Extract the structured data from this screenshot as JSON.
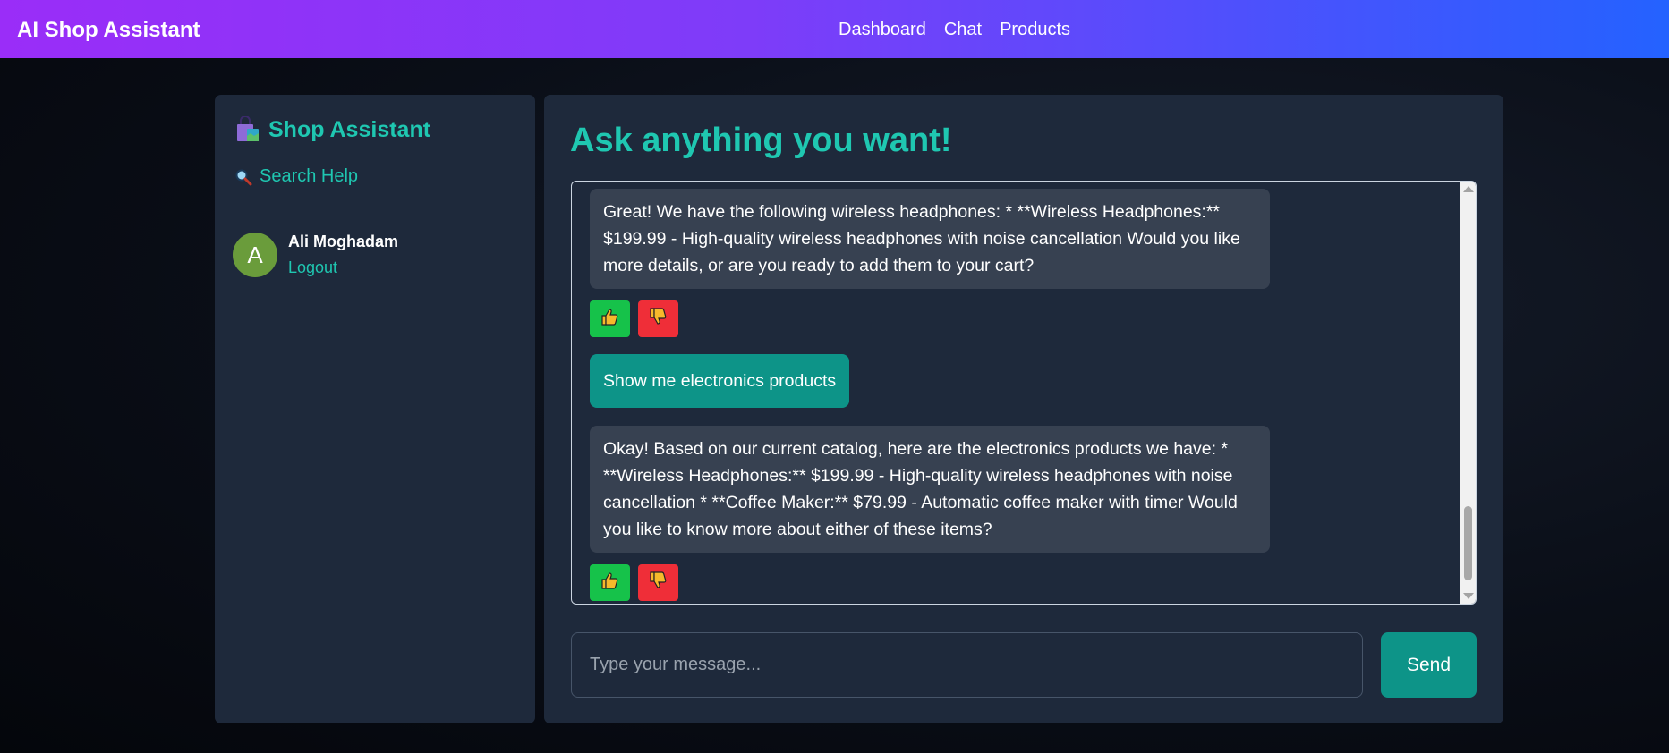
{
  "app": {
    "brand": "AI Shop Assistant",
    "nav": [
      "Dashboard",
      "Chat",
      "Products"
    ]
  },
  "sidebar": {
    "title": "Shop Assistant",
    "title_icon": "shopping-bag-icon",
    "search_help": "Search Help",
    "search_icon": "magnifying-glass-icon",
    "user": {
      "initial": "A",
      "name": "Ali Moghadam",
      "logout": "Logout"
    }
  },
  "chat": {
    "title": "Ask anything you want!",
    "messages": [
      {
        "role": "assistant",
        "text": "Great! We have the following wireless headphones: * **Wireless Headphones:** $199.99 - High-quality wireless headphones with noise cancellation Would you like more details, or are you ready to add them to your cart?"
      },
      {
        "role": "user",
        "text": "Show me electronics products"
      },
      {
        "role": "assistant",
        "text": "Okay! Based on our current catalog, here are the electronics products we have: * **Wireless Headphones:** $199.99 - High-quality wireless headphones with noise cancellation * **Coffee Maker:** $79.99 - Automatic coffee maker with timer Would you like to know more about either of these items?"
      }
    ],
    "input_placeholder": "Type your message...",
    "send_label": "Send"
  },
  "colors": {
    "accent": "#1fc7b1",
    "user_bubble": "#0d9488",
    "bot_bubble": "#374151",
    "panel": "#1e293b",
    "thumbs_up": "#16c24a",
    "thumbs_down": "#ef2e38"
  }
}
